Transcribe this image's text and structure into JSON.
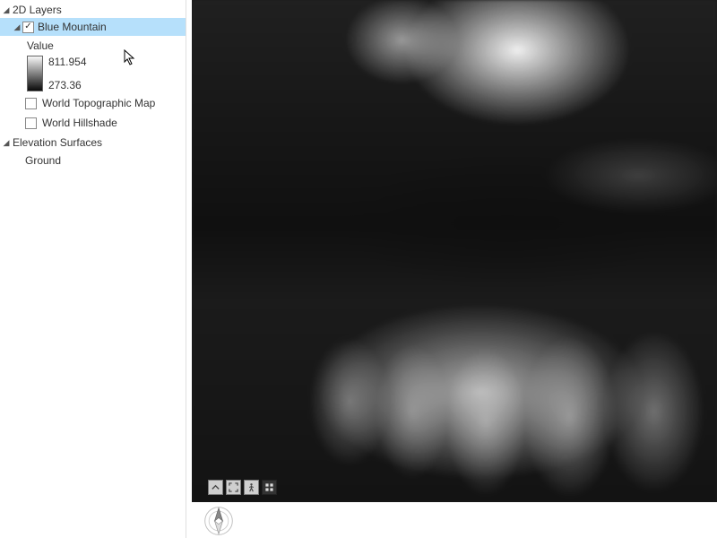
{
  "sidebar": {
    "groups": [
      {
        "label": "2D Layers",
        "items": [
          {
            "label": "Blue Mountain",
            "checked": true,
            "selected": true,
            "value_title": "Value",
            "ramp_high": "811.954",
            "ramp_low": "273.36"
          },
          {
            "label": "World Topographic Map",
            "checked": false
          },
          {
            "label": "World Hillshade",
            "checked": false
          }
        ]
      },
      {
        "label": "Elevation Surfaces",
        "items": [
          {
            "label": "Ground"
          }
        ]
      }
    ]
  },
  "nav": {
    "explore": "explore-icon",
    "full_extent": "full-extent-icon",
    "fixed_zoom": "pedestrian-icon",
    "bookmarks": "grid-icon"
  }
}
